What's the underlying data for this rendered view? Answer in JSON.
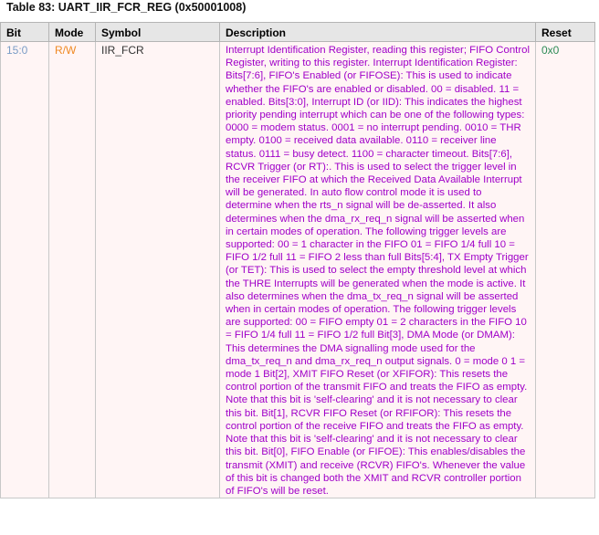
{
  "caption": "Table 83: UART_IIR_FCR_REG (0x50001008)",
  "headers": {
    "bit": "Bit",
    "mode": "Mode",
    "symbol": "Symbol",
    "description": "Description",
    "reset": "Reset"
  },
  "row": {
    "bit": "15:0",
    "mode": "R/W",
    "symbol": "IIR_FCR",
    "reset": "0x0",
    "description": "Interrupt Identification Register, reading this register; FIFO Control Register, writing to this register. Interrupt Identification Register: Bits[7:6], FIFO's Enabled (or FIFOSE): This is used to indicate whether the FIFO's are enabled or disabled. 00 = disabled. 11 = enabled. Bits[3:0], Interrupt ID (or IID): This indicates the highest priority pending interrupt which can be one of the following types: 0000 = modem status. 0001 = no interrupt pending. 0010 = THR empty. 0100 = received data available. 0110 = receiver line status. 0111 = busy detect. 1100 = character timeout. Bits[7:6], RCVR Trigger (or RT):. This is used to select the trigger level in the receiver FIFO at which the Received Data Available Interrupt will be generated. In auto flow control mode it is used to determine when the rts_n signal will be de-asserted. It also determines when the dma_rx_req_n signal will be asserted when in certain modes of operation. The following trigger levels are supported: 00 = 1 character in the FIFO 01 = FIFO 1/4 full 10 = FIFO 1/2 full 11 = FIFO 2 less than full Bits[5:4], TX Empty Trigger (or TET): This is used to select the empty threshold level at which the THRE Interrupts will be generated when the mode is active. It also determines when the dma_tx_req_n signal will be asserted when in certain modes of operation. The following trigger levels are supported: 00 = FIFO empty 01 = 2 characters in the FIFO 10 = FIFO 1/4 full 11 = FIFO 1/2 full Bit[3], DMA Mode (or DMAM): This determines the DMA signalling mode used for the dma_tx_req_n and dma_rx_req_n output signals. 0 = mode 0 1 = mode 1 Bit[2], XMIT FIFO Reset (or XFIFOR): This resets the control portion of the transmit FIFO and treats the FIFO as empty. Note that this bit is 'self-clearing' and it is not necessary to clear this bit. Bit[1], RCVR FIFO Reset (or RFIFOR): This resets the control portion of the receive FIFO and treats the FIFO as empty. Note that this bit is 'self-clearing' and it is not necessary to clear this bit. Bit[0], FIFO Enable (or FIFOE): This enables/disables the transmit (XMIT) and receive (RCVR) FIFO's. Whenever the value of this bit is changed both the XMIT and RCVR controller portion of FIFO's will be reset."
  }
}
